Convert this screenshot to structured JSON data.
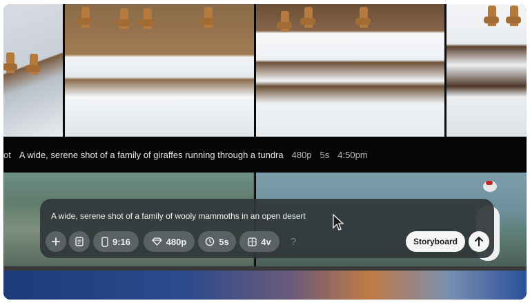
{
  "caption": {
    "cut_prefix": "ot",
    "text": "A wide, serene shot of a family of giraffes running through a tundra",
    "resolution": "480p",
    "duration": "5s",
    "time": "4:50pm"
  },
  "composer": {
    "prompt": "A wide, serene shot of a family of wooly mammoths in an open desert",
    "aspect_label": "9:16",
    "resolution_label": "480p",
    "duration_label": "5s",
    "variations_label": "4v",
    "help_label": "?",
    "storyboard_label": "Storyboard"
  },
  "icons": {
    "add": "plus-icon",
    "preset": "document-icon",
    "aspect": "phone-portrait-icon",
    "quality": "diamond-icon",
    "duration": "clock-icon",
    "variations": "grid-icon",
    "submit": "arrow-up-icon",
    "cursor": "mouse-pointer-icon"
  },
  "colors": {
    "panel": "#303638",
    "pill": "#5f6668",
    "button_light": "#f5f5f5"
  }
}
